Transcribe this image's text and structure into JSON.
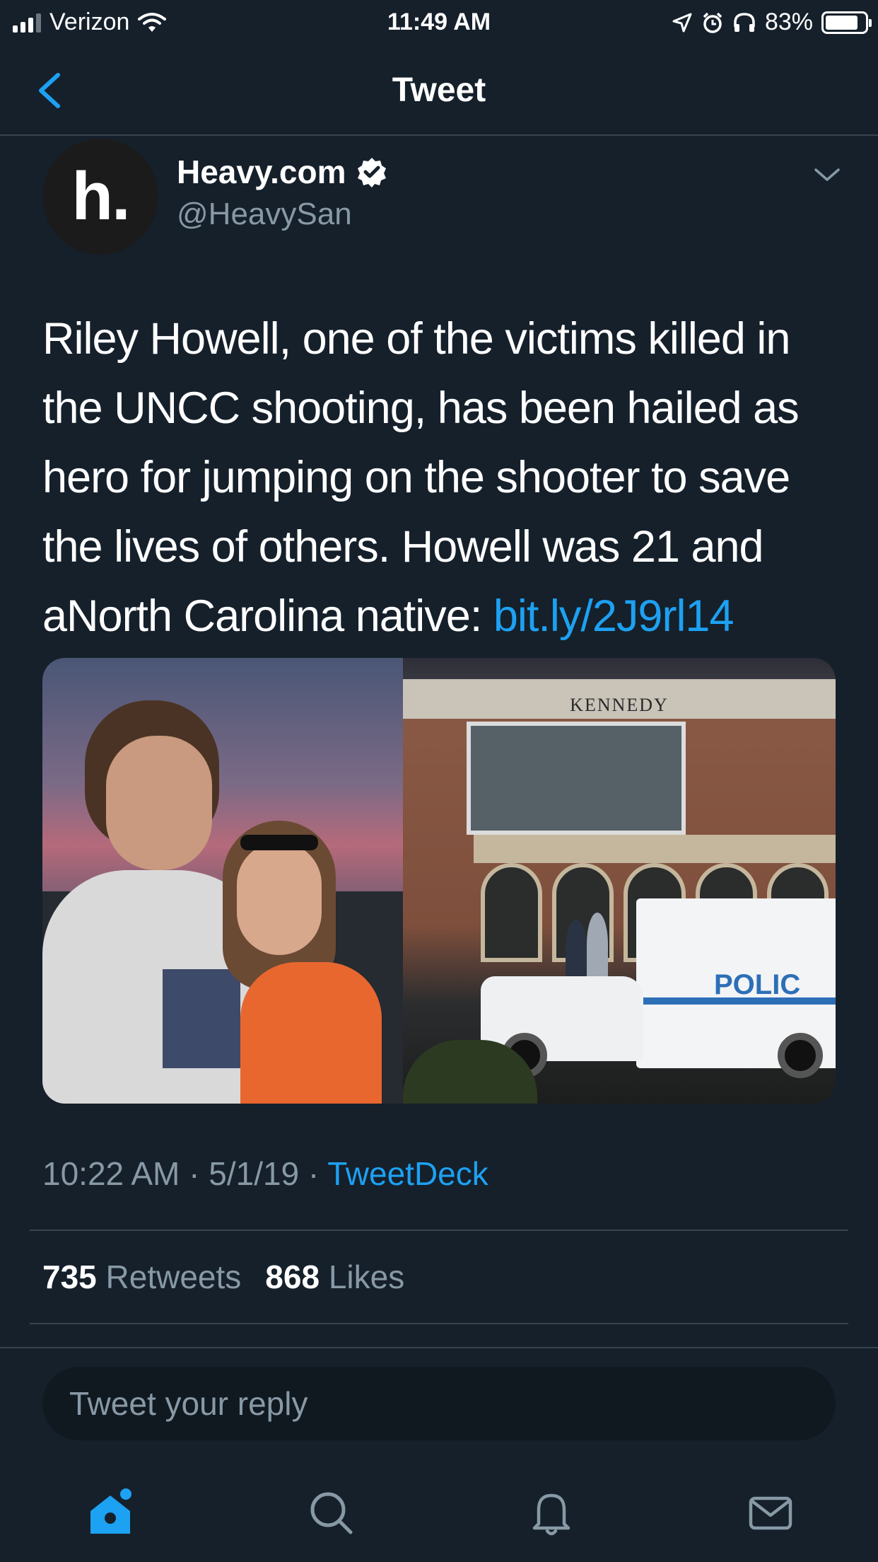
{
  "status_bar": {
    "carrier": "Verizon",
    "time": "11:49 AM",
    "battery_percent": "83%",
    "battery_level": 0.83
  },
  "nav": {
    "title": "Tweet",
    "back_icon": "chevron-left-icon"
  },
  "tweet": {
    "avatar_text": "h.",
    "display_name": "Heavy.com",
    "handle": "@HeavySan",
    "text": "Riley Howell, one of the victims killed in the UNCC shooting, has been hailed as hero for jumping on the shooter to save the lives of others. Howell was 21 and aNorth Carolina native: ",
    "link": "bit.ly/2J9rl14",
    "media": {
      "right_photo_sign": "KENNEDY",
      "truck_label": "POLIC"
    },
    "time": "10:22 AM",
    "separator": " · ",
    "date": "5/1/19",
    "source": "TweetDeck",
    "retweets_count": "735",
    "retweets_label": "Retweets",
    "likes_count": "868",
    "likes_label": "Likes"
  },
  "reply": {
    "placeholder": "Tweet your reply"
  },
  "tab_bar": {
    "items": [
      "home-icon",
      "search-icon",
      "bell-icon",
      "mail-icon"
    ]
  },
  "colors": {
    "background": "#15202b",
    "accent": "#1da1f2",
    "secondary_text": "#8899a6"
  }
}
